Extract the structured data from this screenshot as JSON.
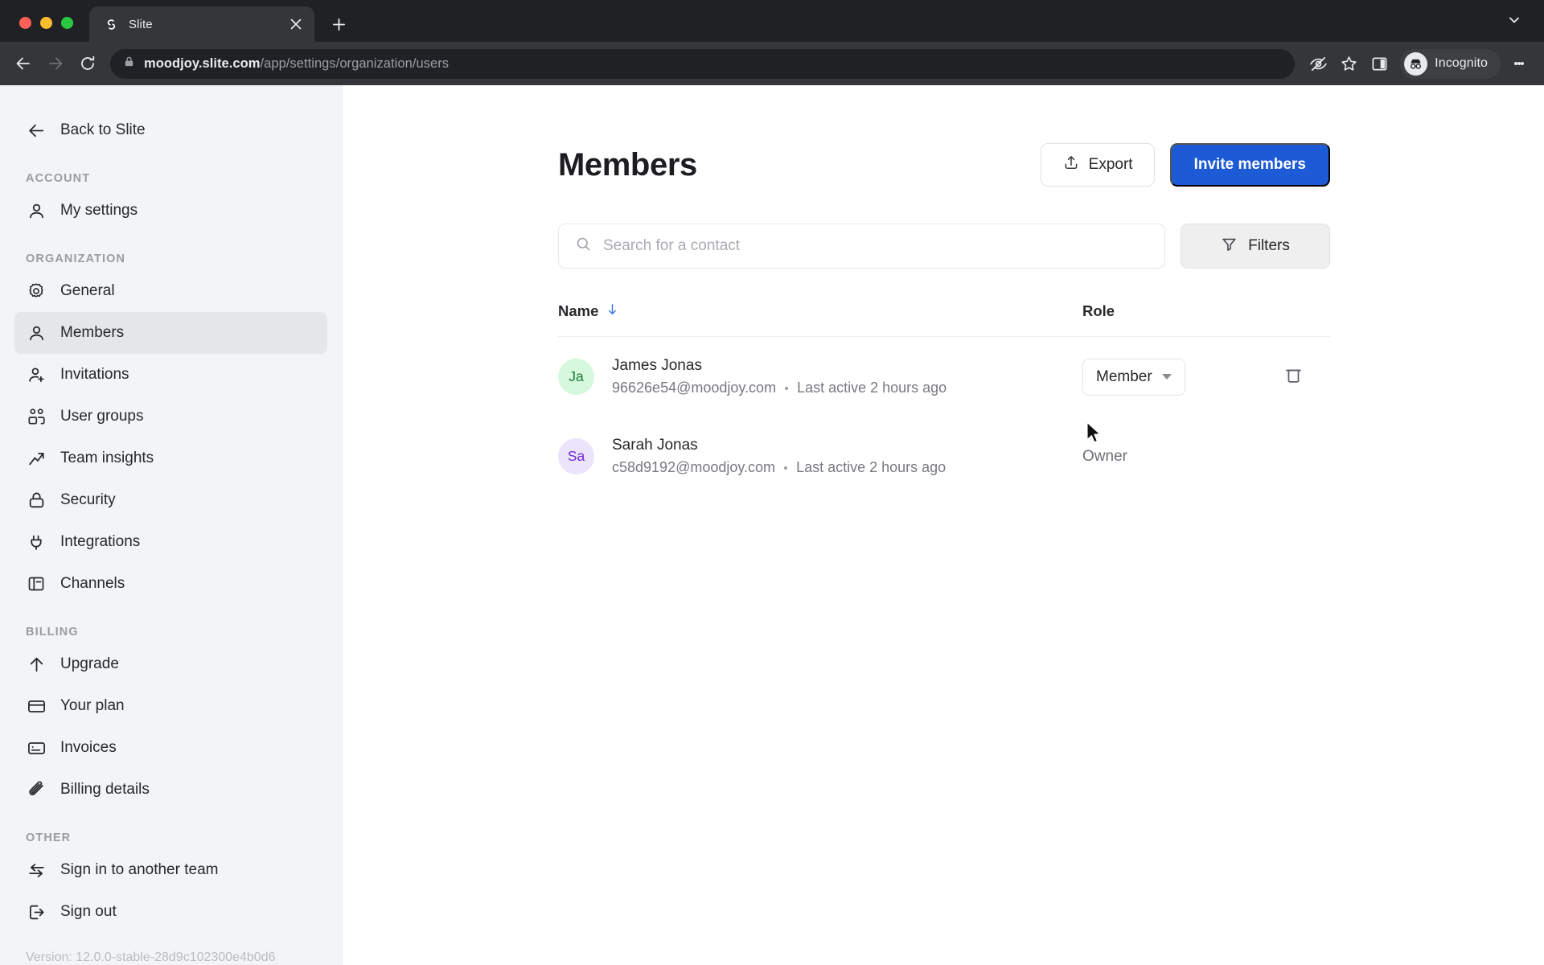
{
  "browser": {
    "tab": {
      "title": "Slite",
      "favicon": "slite-logo-icon"
    },
    "new_tab_label": "+",
    "url_host": "moodjoy.slite.com",
    "url_path": "/app/settings/organization/users",
    "profile_label": "Incognito",
    "toolbar_icons": [
      "back-icon",
      "forward-icon",
      "reload-icon",
      "lock-icon",
      "tracking-protection-icon",
      "bookmark-star-icon",
      "side-panel-icon",
      "incognito-avatar-icon",
      "more-menu-icon"
    ]
  },
  "sidebar": {
    "back": {
      "label": "Back to Slite",
      "icon": "arrow-left-icon"
    },
    "sections": [
      {
        "label": "Account",
        "items": [
          {
            "label": "My settings",
            "icon": "user-icon",
            "active": false
          }
        ]
      },
      {
        "label": "Organization",
        "items": [
          {
            "label": "General",
            "icon": "gear-icon",
            "active": false
          },
          {
            "label": "Members",
            "icon": "user-icon",
            "active": true
          },
          {
            "label": "Invitations",
            "icon": "user-plus-icon",
            "active": false
          },
          {
            "label": "User groups",
            "icon": "users-icon",
            "active": false
          },
          {
            "label": "Team insights",
            "icon": "trending-up-icon",
            "active": false
          },
          {
            "label": "Security",
            "icon": "lock-icon",
            "active": false
          },
          {
            "label": "Integrations",
            "icon": "plug-icon",
            "active": false
          },
          {
            "label": "Channels",
            "icon": "panel-icon",
            "active": false
          }
        ]
      },
      {
        "label": "Billing",
        "items": [
          {
            "label": "Upgrade",
            "icon": "arrow-up-icon",
            "active": false
          },
          {
            "label": "Your plan",
            "icon": "credit-card-icon",
            "active": false
          },
          {
            "label": "Invoices",
            "icon": "invoice-icon",
            "active": false
          },
          {
            "label": "Billing details",
            "icon": "paperclip-icon",
            "active": false
          }
        ]
      },
      {
        "label": "Other",
        "items": [
          {
            "label": "Sign in to another team",
            "icon": "switch-arrows-icon",
            "active": false
          },
          {
            "label": "Sign out",
            "icon": "logout-icon",
            "active": false
          }
        ]
      }
    ],
    "version": "Version: 12.0.0-stable-28d9c102300e4b0d6"
  },
  "main": {
    "title": "Members",
    "export_label": "Export",
    "invite_label": "Invite members",
    "search": {
      "placeholder": "Search for a contact",
      "value": ""
    },
    "filters_label": "Filters",
    "columns": {
      "name": "Name",
      "role": "Role",
      "sort_direction": "descending"
    },
    "members": [
      {
        "initials": "Ja",
        "name": "James Jonas",
        "email": "96626e54@moodjoy.com",
        "last_active": "Last active 2 hours ago",
        "role": "Member",
        "role_editable": true,
        "avatar_bg": "#d6f8dc",
        "avatar_fg": "#1e7a3c",
        "has_delete": true
      },
      {
        "initials": "Sa",
        "name": "Sarah Jonas",
        "email": "c58d9192@moodjoy.com",
        "last_active": "Last active 2 hours ago",
        "role": "Owner",
        "role_editable": false,
        "avatar_bg": "#ece4fb",
        "avatar_fg": "#6d28d9",
        "has_delete": false
      }
    ]
  },
  "colors": {
    "primary": "#1d5bd6",
    "sort_arrow": "#3b74e0",
    "sidebar_bg": "#f3f4f6",
    "sidebar_active": "#e4e6e9",
    "chrome_bg": "#202124",
    "chrome_toolbar": "#35363a"
  }
}
